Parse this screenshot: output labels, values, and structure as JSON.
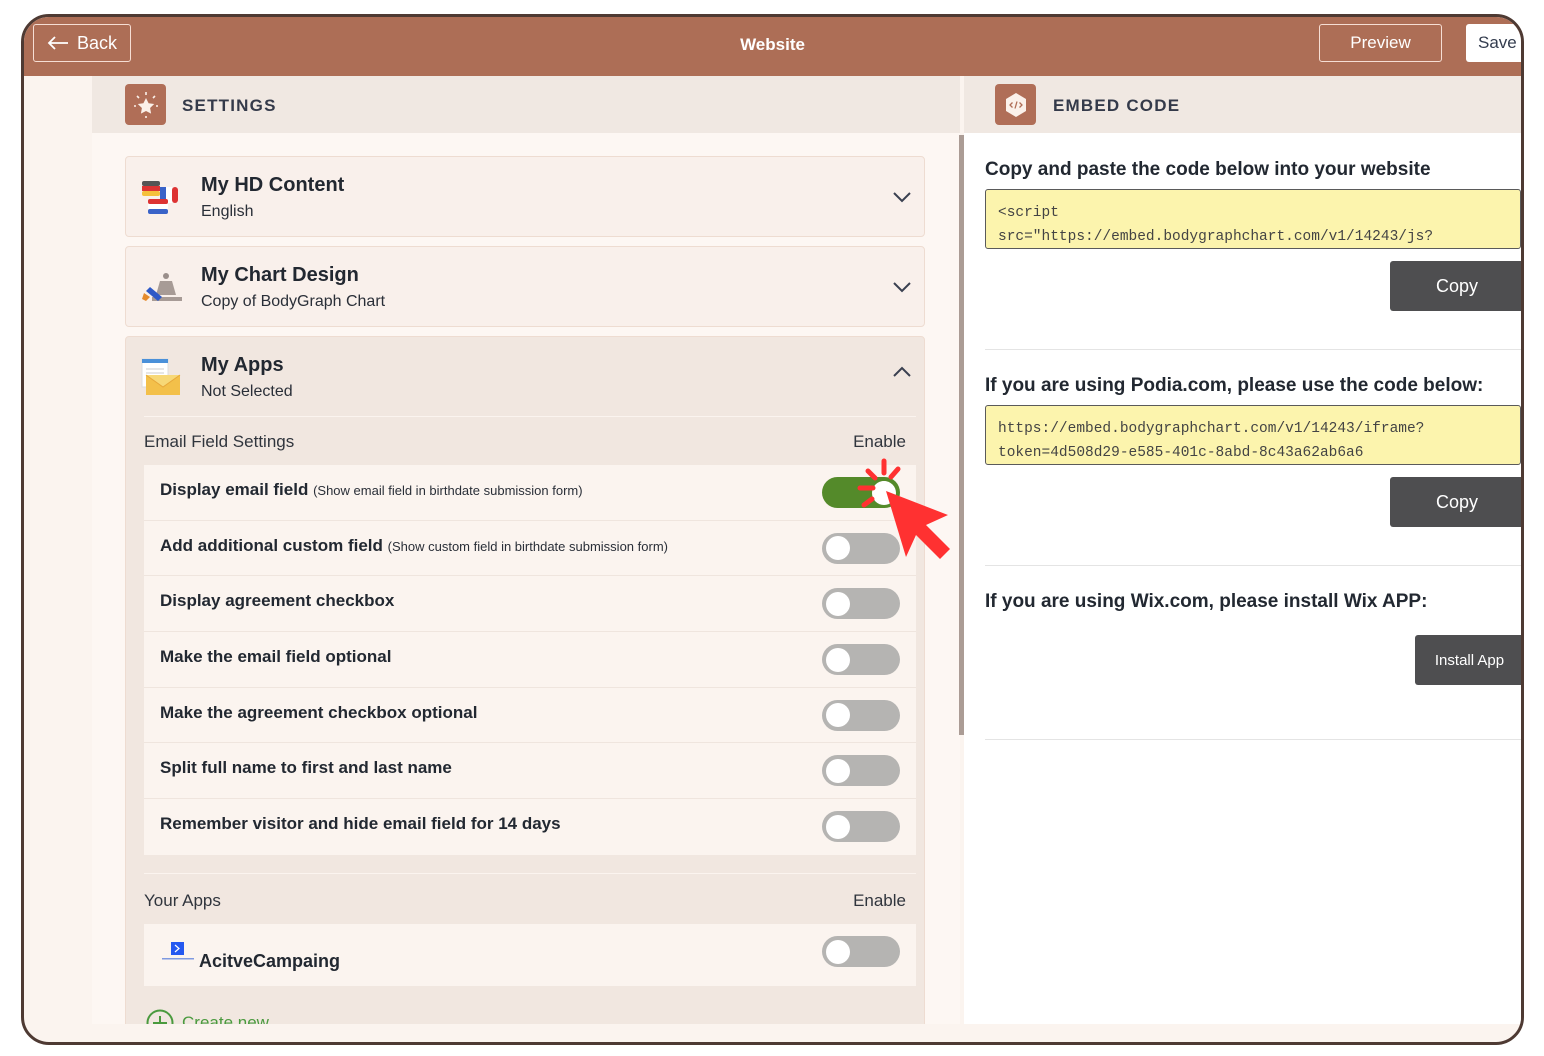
{
  "topbar": {
    "back_label": "Back",
    "title": "Website",
    "preview_label": "Preview",
    "save_label": "Save changes"
  },
  "settings": {
    "header": "SETTINGS",
    "icon": "star-sparkle-icon",
    "accordions": [
      {
        "title": "My HD Content",
        "subtitle": "English",
        "icon": "language-flags-icon",
        "expanded": false
      },
      {
        "title": "My Chart Design",
        "subtitle": "Copy of BodyGraph Chart",
        "icon": "chart-design-icon",
        "expanded": false
      },
      {
        "title": "My Apps",
        "subtitle": "Not Selected",
        "icon": "email-app-icon",
        "expanded": true
      }
    ],
    "email_field_settings": {
      "heading": "Email Field Settings",
      "enable_label": "Enable",
      "rows": [
        {
          "label": "Display email field",
          "note": "(Show email field in birthdate submission form)",
          "enabled": true
        },
        {
          "label": "Add additional custom field",
          "note": "(Show custom field in birthdate submission form)",
          "enabled": false
        },
        {
          "label": "Display agreement checkbox",
          "note": "",
          "enabled": false
        },
        {
          "label": "Make the email field optional",
          "note": "",
          "enabled": false
        },
        {
          "label": "Make the agreement checkbox optional",
          "note": "",
          "enabled": false
        },
        {
          "label": "Split full name to first and last name",
          "note": "",
          "enabled": false
        },
        {
          "label": "Remember visitor and hide email field for 14 days",
          "note": "",
          "enabled": false
        }
      ]
    },
    "your_apps": {
      "heading": "Your Apps",
      "enable_label": "Enable",
      "apps": [
        {
          "name": "AcitveCampaing",
          "enabled": false
        }
      ],
      "create_new_label": "Create new"
    }
  },
  "embed": {
    "header": "EMBED CODE",
    "icon": "code-hexagon-icon",
    "blocks": [
      {
        "heading": "Copy and paste the code below into your website",
        "code": "<script\nsrc=\"https://embed.bodygraphchart.com/v1/14243/js?",
        "button": "Copy"
      },
      {
        "heading": "If you are using Podia.com, please use the code below:",
        "code": "https://embed.bodygraphchart.com/v1/14243/iframe?\ntoken=4d508d29-e585-401c-8abd-8c43a62ab6a6",
        "button": "Copy"
      },
      {
        "heading": "If you are using Wix.com, please install Wix APP:",
        "button": "Install App"
      }
    ]
  },
  "colors": {
    "brand": "#ad6e56",
    "toggle_on": "#548a2a",
    "toggle_off": "#b5b4b2",
    "code_bg": "#fcf4ad",
    "button_dark": "#4e4e50",
    "annotation": "#ff3131"
  }
}
